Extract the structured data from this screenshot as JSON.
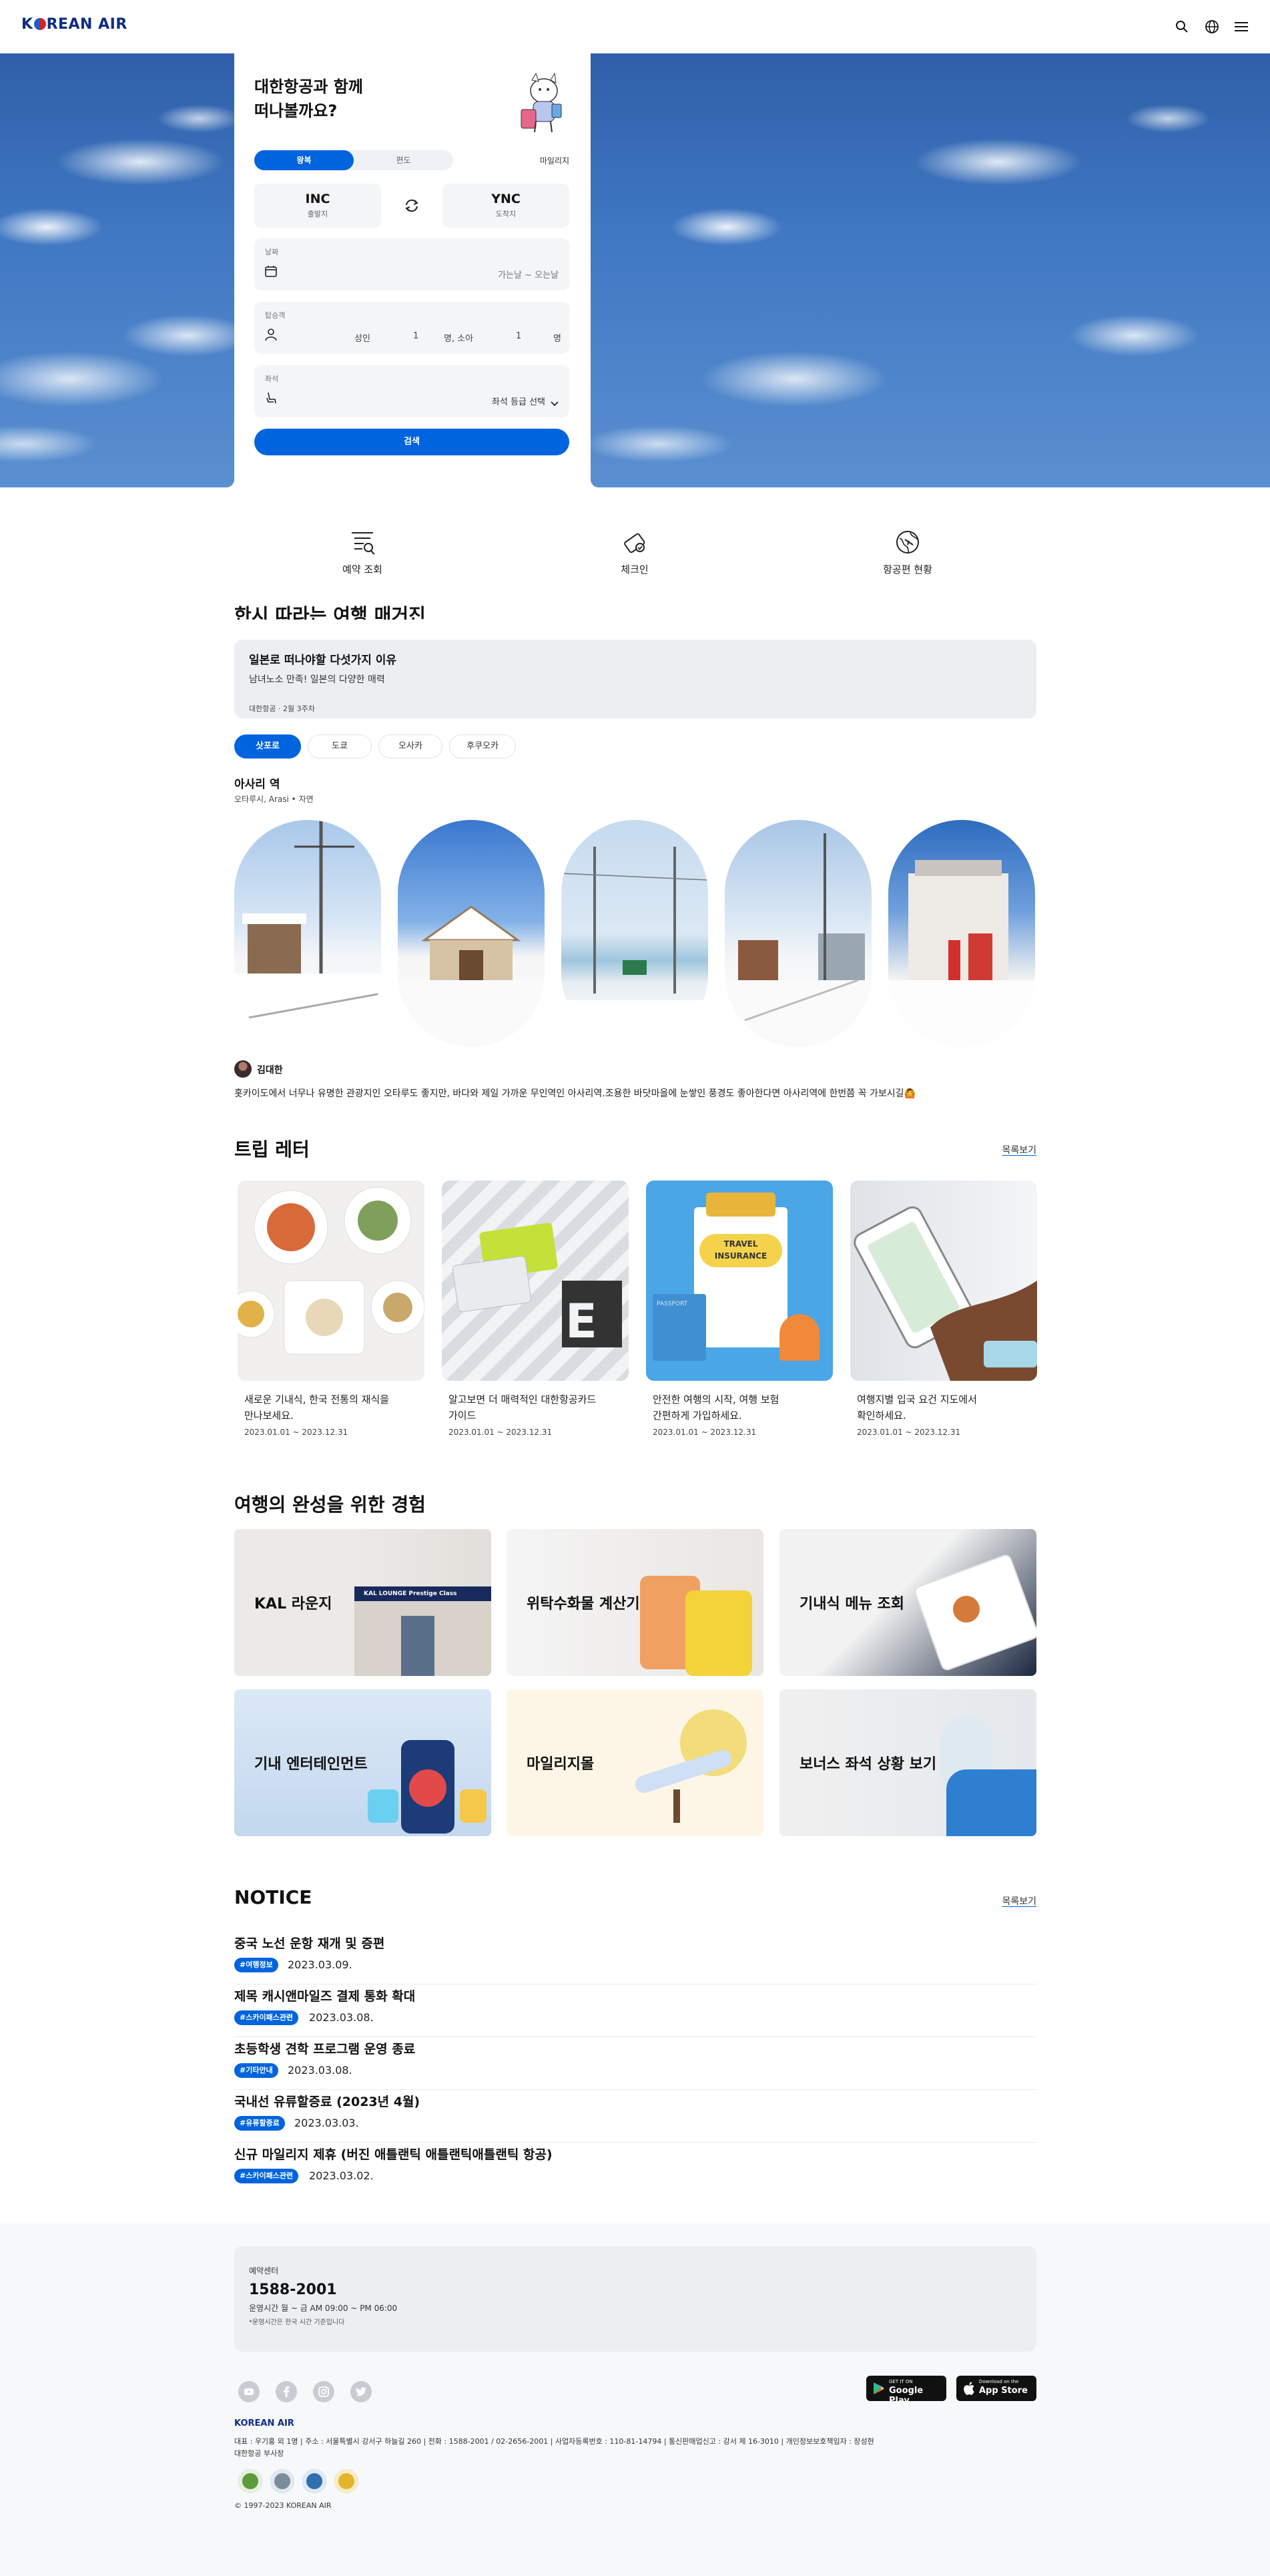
{
  "header": {
    "logo": "KOREAN AIR",
    "icons": [
      "search-icon",
      "globe-icon",
      "menu-icon"
    ]
  },
  "booking": {
    "title_line1": "대한항공과 함께",
    "title_line2": "떠나볼까요?",
    "tabs": [
      "왕복",
      "편도"
    ],
    "mileage_link": "마일리지",
    "origin": {
      "code": "INC",
      "label": "출발지"
    },
    "destination": {
      "code": "YNC",
      "label": "도착지"
    },
    "date": {
      "label": "날짜",
      "value": "가는날 ~ 오는날"
    },
    "passengers": {
      "label": "탑승객",
      "adult_label": "성인",
      "adult_count": "1",
      "child_label": "명, 소아",
      "child_count": "1",
      "unit": "명"
    },
    "seat": {
      "label": "좌석",
      "value": "좌석 등급 선택"
    },
    "search_label": "검색"
  },
  "quick_menu": [
    {
      "label": "예약 조회",
      "icon": "reservation-search-icon"
    },
    {
      "label": "체크인",
      "icon": "checkin-icon"
    },
    {
      "label": "항공편 현황",
      "icon": "flight-status-icon"
    }
  ],
  "travel_magazine": {
    "title": "한시 따라는 여행 매거진",
    "article": {
      "title": "일본로 떠나야할 다섯가지 이유",
      "subtitle": "남녀노소 만족! 일본의 다양한 매력",
      "meta": "대한항공 · 2월 3주차"
    },
    "cities": [
      "삿포로",
      "도쿄",
      "오사카",
      "후쿠오카"
    ],
    "place": {
      "name": "아사리 역",
      "tags": "오타루시, Arasi • 자연"
    },
    "author": "김대한",
    "comment": "홋카이도에서 너무나 유명한 관광지인 오타루도 좋지만, 바다와 제일 가까운 무인역인 아사리역.조용한 바닷마을에 눈쌓인 풍경도 좋아한다면 아사리역에 한번쯤 꼭 가보시길🙆"
  },
  "trip_letter": {
    "title": "트립 레터",
    "more": "목록보기",
    "cards": [
      {
        "line1": "새로운 기내식, 한국 전통의 재식을",
        "line2": "만나보세요.",
        "date": "2023.01.01 ~ 2023.12.31"
      },
      {
        "line1": "알고보면 더 매력적인 대한항공카드",
        "line2": "가이드",
        "date": "2023.01.01 ~ 2023.12.31"
      },
      {
        "line1": "안전한 여행의 시작, 여행 보험",
        "line2": "간편하게 가입하세요.",
        "date": "2023.01.01 ~ 2023.12.31"
      },
      {
        "line1": "여행지별 입국 요건 지도에서",
        "line2": "확인하세요.",
        "date": "2023.01.01 ~ 2023.12.31"
      }
    ],
    "insurance_text": "TRAVEL INSURANCE",
    "passport_text": "PASSPORT",
    "kal_lounge_sign": "KAL LOUNGE Prestige Class"
  },
  "experience": {
    "title": "여행의 완성을 위한 경험",
    "items": [
      "KAL 라운지",
      "위탁수화물 계산기",
      "기내식 메뉴 조회",
      "기내 엔터테인먼트",
      "마일리지몰",
      "보너스 좌석 상황 보기"
    ]
  },
  "notice": {
    "title": "NOTICE",
    "more": "목록보기",
    "items": [
      {
        "title": "중국 노선 운항 재개 및 증편",
        "tag": "#여행정보",
        "date": "2023.03.09."
      },
      {
        "title": "제목 캐시앤마일즈 결제 통화 확대",
        "tag": "#스카이패스관련",
        "date": "2023.03.08."
      },
      {
        "title": "초등학생 견학 프로그램 운영 종료",
        "tag": "#기타안내",
        "date": "2023.03.08."
      },
      {
        "title": "국내선 유류할증료 (2023년 4월)",
        "tag": "#유류할증료",
        "date": "2023.03.03."
      },
      {
        "title": "신규 마일리지 제휴 (버진 애틀랜틱 애틀랜틱애틀랜틱 항공)",
        "tag": "#스카이패스관련",
        "date": "2023.03.02."
      }
    ]
  },
  "footer": {
    "cs_label": "예약센터",
    "cs_phone": "1588-2001",
    "cs_hours": "운영시간 월 ~ 금 AM 09:00 ~ PM 06:00",
    "cs_note": "*운영시간은 한국 시간 기준입니다",
    "sns_icons": [
      "youtube-icon",
      "facebook-icon",
      "instagram-icon",
      "twitter-icon"
    ],
    "google_play": {
      "small": "GET IT ON",
      "big": "Google Play"
    },
    "app_store": {
      "small": "Download on the",
      "big": "App Store"
    },
    "logo": "KOREAN AIR",
    "company_info": "대표 : 우기홍 외 1명 | 주소 : 서울특별시 강서구 하늘길 260 | 전화 : 1588-2001 / 02-2656-2001 | 사업자등록번호 : 110-81-14794 | 통신판매업신고 : 강서 제 16-3010 | 개인정보보호책임자 : 장성현",
    "company_info2": "대한항공 부사장",
    "copyright": "© 1997-2023 KOREAN AIR"
  },
  "colors": {
    "primary": "#0064de",
    "brand_navy": "#0c2d83",
    "sky": "#3f77c2"
  }
}
